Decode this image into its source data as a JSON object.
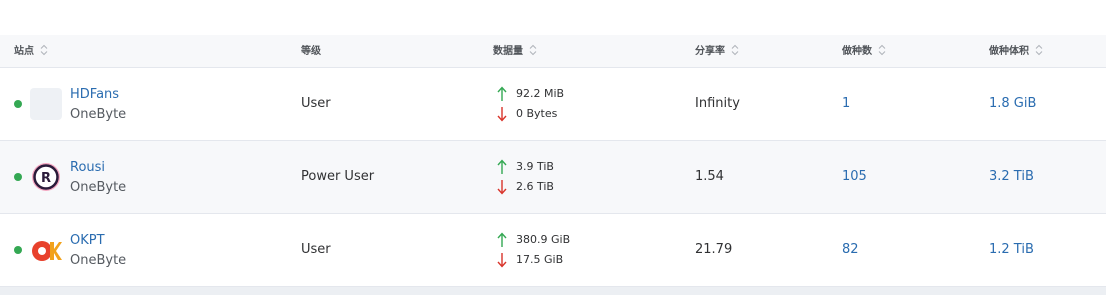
{
  "columns": [
    {
      "label": "站点"
    },
    {
      "label": "等级"
    },
    {
      "label": "数据量"
    },
    {
      "label": "分享率"
    },
    {
      "label": "做种数"
    },
    {
      "label": "做种体积"
    }
  ],
  "rows": [
    {
      "name": "HDFans",
      "sub": "OneByte",
      "level": "User",
      "upload": "92.2 MiB",
      "download": "0 Bytes",
      "ratio": "Infinity",
      "seeds": "1",
      "size": "1.8 GiB",
      "status_color": "#34a853"
    },
    {
      "name": "Rousi",
      "sub": "OneByte",
      "level": "Power User",
      "upload": "3.9 TiB",
      "download": "2.6 TiB",
      "ratio": "1.54",
      "seeds": "105",
      "size": "3.2 TiB",
      "status_color": "#34a853"
    },
    {
      "name": "OKPT",
      "sub": "OneByte",
      "level": "User",
      "upload": "380.9 GiB",
      "download": "17.5 GiB",
      "ratio": "21.79",
      "seeds": "82",
      "size": "1.2 TiB",
      "status_color": "#34a853"
    }
  ],
  "logos": {
    "rousi": "R",
    "okpt": "OK"
  },
  "colors": {
    "link": "#2a6cb0",
    "up_arrow": "#34a853",
    "down_arrow": "#d9342b"
  }
}
